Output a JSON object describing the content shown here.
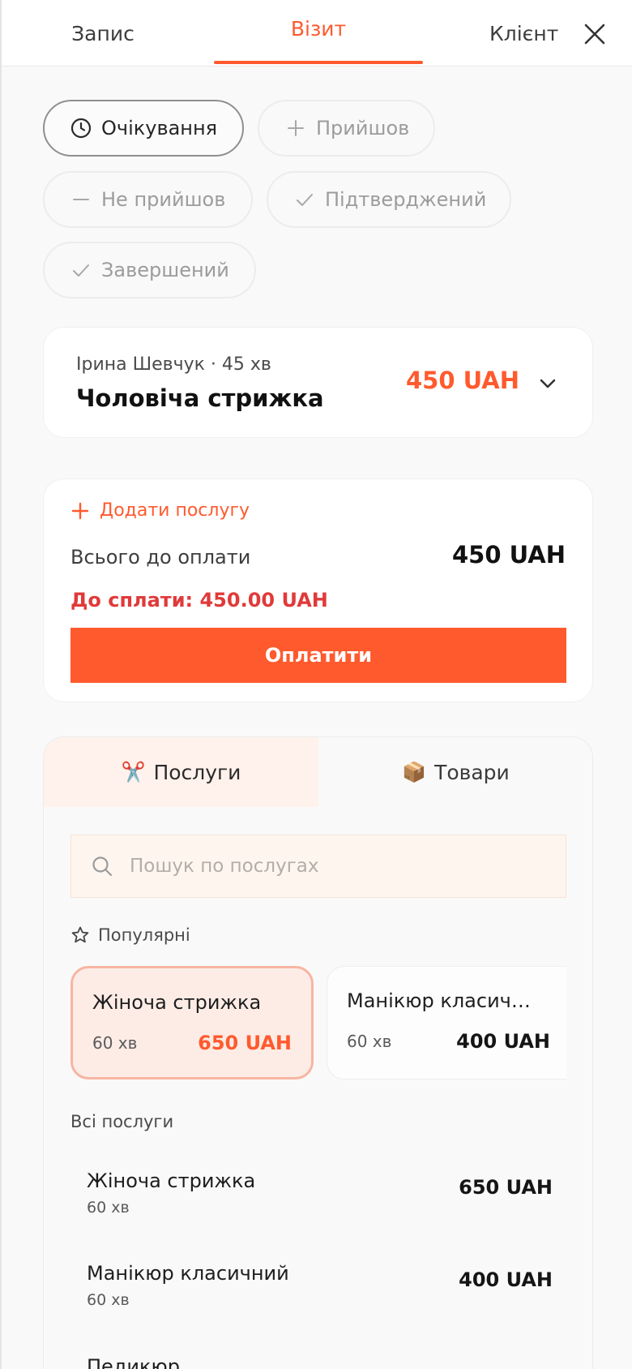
{
  "tabs": [
    {
      "label": "Запис"
    },
    {
      "label": "Візит"
    },
    {
      "label": "Клієнт"
    }
  ],
  "statuses": [
    {
      "label": "Очікування",
      "icon": "clock-icon",
      "active": true
    },
    {
      "label": "Прийшов",
      "icon": "plus-icon"
    },
    {
      "label": "Не прийшов",
      "icon": "minus-icon"
    },
    {
      "label": "Підтверджений",
      "icon": "check-icon"
    },
    {
      "label": "Завершений",
      "icon": "check-icon"
    }
  ],
  "service": {
    "meta": "Ірина Шевчук · 45 хв",
    "name": "Чоловіча стрижка",
    "price": "450 UAH"
  },
  "payment": {
    "add_label": "Додати послугу",
    "total_label": "Всього до оплати",
    "total_value": "450 UAH",
    "due_text": "До сплати: 450.00 UAH",
    "pay_label": "Оплатити"
  },
  "catalog": {
    "tabs": [
      {
        "emoji": "✂️",
        "label": "Послуги"
      },
      {
        "emoji": "📦",
        "label": "Товари"
      }
    ],
    "search_placeholder": "Пошук по послугах",
    "popular_label": "Популярні",
    "popular": [
      {
        "name": "Жіноча стрижка",
        "duration": "60 хв",
        "price": "650 UAH"
      },
      {
        "name": "Манікюр класичний",
        "duration": "60 хв",
        "price": "400 UAH"
      }
    ],
    "all_label": "Всі послуги",
    "all": [
      {
        "name": "Жіноча стрижка",
        "duration": "60 хв",
        "price": "650 UAH"
      },
      {
        "name": "Манікюр класичний",
        "duration": "60 хв",
        "price": "400 UAH"
      },
      {
        "name": "Педикюр"
      }
    ]
  },
  "colors": {
    "accent": "#ff5a2e",
    "due": "#e03a3a"
  }
}
